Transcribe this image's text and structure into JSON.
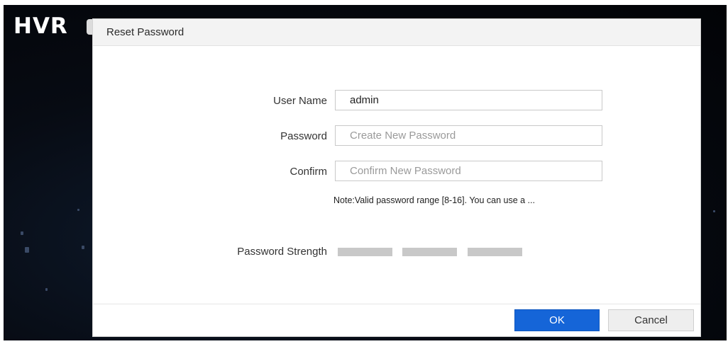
{
  "brand": {
    "text": "HVR"
  },
  "dialog": {
    "title": "Reset Password",
    "fields": {
      "username": {
        "label": "User Name",
        "value": "admin"
      },
      "password": {
        "label": "Password",
        "placeholder": "Create New Password"
      },
      "confirm": {
        "label": "Confirm",
        "placeholder": "Confirm New Password"
      }
    },
    "note": "Note:Valid password range [8-16]. You can use a ...",
    "strength": {
      "label": "Password Strength",
      "segments": 3,
      "filled": 0
    },
    "buttons": {
      "ok": "OK",
      "cancel": "Cancel"
    }
  },
  "colors": {
    "primary_button": "#1565d8",
    "strength_bar_empty": "#c8c8c8",
    "background": "#05080f"
  }
}
